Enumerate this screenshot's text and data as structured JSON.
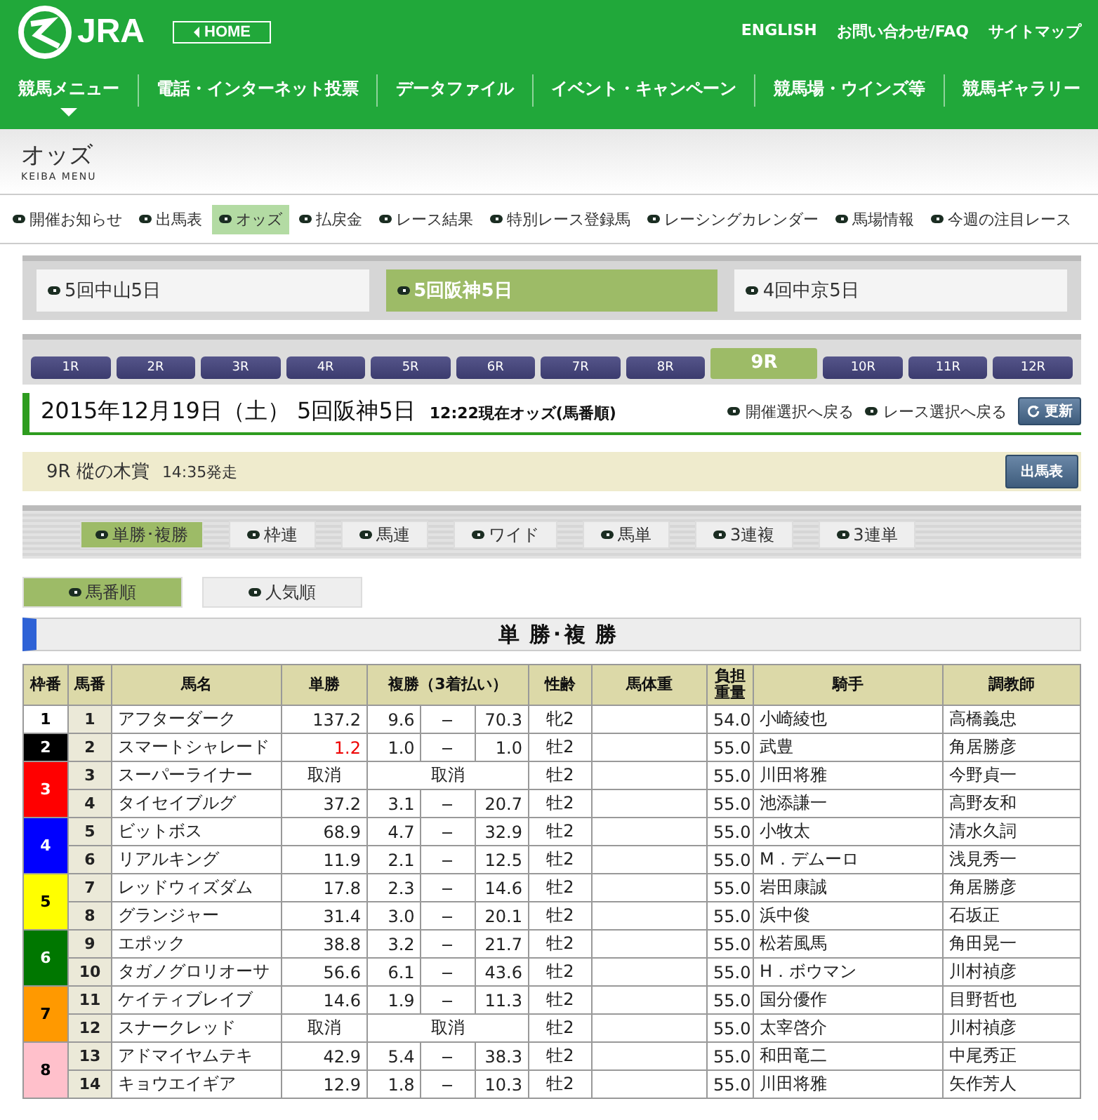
{
  "header": {
    "logo_text": "JRA",
    "home_button": "HOME",
    "utility_links": [
      "ENGLISH",
      "お問い合わせ/FAQ",
      "サイトマップ"
    ],
    "main_nav": [
      {
        "label": "競馬メニュー",
        "selected": true
      },
      {
        "label": "電話・インターネット投票",
        "selected": false
      },
      {
        "label": "データファイル",
        "selected": false
      },
      {
        "label": "イベント・キャンペーン",
        "selected": false
      },
      {
        "label": "競馬場・ウインズ等",
        "selected": false
      },
      {
        "label": "競馬ギャラリー",
        "selected": false
      }
    ]
  },
  "page_title": "オッズ",
  "page_subtitle": "KEIBA MENU",
  "sub_nav": [
    {
      "label": "開催お知らせ",
      "selected": false
    },
    {
      "label": "出馬表",
      "selected": false
    },
    {
      "label": "オッズ",
      "selected": true
    },
    {
      "label": "払戻金",
      "selected": false
    },
    {
      "label": "レース結果",
      "selected": false
    },
    {
      "label": "特別レース登録馬",
      "selected": false
    },
    {
      "label": "レーシングカレンダー",
      "selected": false
    },
    {
      "label": "馬場情報",
      "selected": false
    },
    {
      "label": "今週の注目レース",
      "selected": false
    }
  ],
  "venues": [
    {
      "label": "5回中山5日",
      "selected": false
    },
    {
      "label": "5回阪神5日",
      "selected": true
    },
    {
      "label": "4回中京5日",
      "selected": false
    }
  ],
  "races": [
    {
      "label": "1R",
      "selected": false
    },
    {
      "label": "2R",
      "selected": false
    },
    {
      "label": "3R",
      "selected": false
    },
    {
      "label": "4R",
      "selected": false
    },
    {
      "label": "5R",
      "selected": false
    },
    {
      "label": "6R",
      "selected": false
    },
    {
      "label": "7R",
      "selected": false
    },
    {
      "label": "8R",
      "selected": false
    },
    {
      "label": "9R",
      "selected": true
    },
    {
      "label": "10R",
      "selected": false
    },
    {
      "label": "11R",
      "selected": false
    },
    {
      "label": "12R",
      "selected": false
    }
  ],
  "heading": {
    "title": "2015年12月19日（土） 5回阪神5日",
    "timestamp": "12:22現在オッズ(馬番順)",
    "back_links": [
      "開催選択へ戻る",
      "レース選択へ戻る"
    ],
    "refresh_button": "更新"
  },
  "race_info": {
    "name": "9R 樅の木賞",
    "start": "14:35発走",
    "entry_button": "出馬表"
  },
  "bet_types": [
    {
      "label": "単勝･複勝",
      "selected": true
    },
    {
      "label": "枠連",
      "selected": false
    },
    {
      "label": "馬連",
      "selected": false
    },
    {
      "label": "ワイド",
      "selected": false
    },
    {
      "label": "馬単",
      "selected": false
    },
    {
      "label": "3連複",
      "selected": false
    },
    {
      "label": "3連単",
      "selected": false
    }
  ],
  "sort_tabs": [
    {
      "label": "馬番順",
      "selected": true
    },
    {
      "label": "人気順",
      "selected": false
    }
  ],
  "section_title": "単 勝･複 勝",
  "table": {
    "columns": [
      "枠番",
      "馬番",
      "馬名",
      "単勝",
      "複勝（3着払い）",
      "性齢",
      "馬体重",
      "負担重量",
      "騎手",
      "調教師"
    ],
    "frames": [
      {
        "number": "1",
        "color": "#ffffff",
        "horses": [
          {
            "kind": "normal",
            "number": "1",
            "name": "アフターダーク",
            "win": "137.2",
            "favorite": false,
            "place_low": "9.6",
            "place_high": "70.3",
            "sex_age": "牝2",
            "weight": "54.0",
            "jockey": "小崎綾也",
            "trainer": "高橋義忠"
          }
        ]
      },
      {
        "number": "2",
        "color": "#000000",
        "horses": [
          {
            "kind": "normal",
            "number": "2",
            "name": "スマートシャレード",
            "win": "1.2",
            "favorite": true,
            "place_low": "1.0",
            "place_high": "1.0",
            "sex_age": "牡2",
            "weight": "55.0",
            "jockey": "武豊",
            "trainer": "角居勝彦"
          }
        ]
      },
      {
        "number": "3",
        "color": "#ff0000",
        "horses": [
          {
            "kind": "scratched",
            "number": "3",
            "name": "スーパーライナー",
            "win": "取消",
            "place": "取消",
            "sex_age": "牡2",
            "weight": "55.0",
            "jockey": "川田将雅",
            "trainer": "今野貞一"
          },
          {
            "kind": "normal",
            "number": "4",
            "name": "タイセイブルグ",
            "win": "37.2",
            "favorite": false,
            "place_low": "3.1",
            "place_high": "20.7",
            "sex_age": "牡2",
            "weight": "55.0",
            "jockey": "池添謙一",
            "trainer": "高野友和"
          }
        ]
      },
      {
        "number": "4",
        "color": "#0000ff",
        "horses": [
          {
            "kind": "normal",
            "number": "5",
            "name": "ビットボス",
            "win": "68.9",
            "favorite": false,
            "place_low": "4.7",
            "place_high": "32.9",
            "sex_age": "牡2",
            "weight": "55.0",
            "jockey": "小牧太",
            "trainer": "清水久詞"
          },
          {
            "kind": "normal",
            "number": "6",
            "name": "リアルキング",
            "win": "11.9",
            "favorite": false,
            "place_low": "2.1",
            "place_high": "12.5",
            "sex_age": "牡2",
            "weight": "55.0",
            "jockey": "M．デムーロ",
            "trainer": "浅見秀一"
          }
        ]
      },
      {
        "number": "5",
        "color": "#ffff00",
        "horses": [
          {
            "kind": "normal",
            "number": "7",
            "name": "レッドウィズダム",
            "win": "17.8",
            "favorite": false,
            "place_low": "2.3",
            "place_high": "14.6",
            "sex_age": "牡2",
            "weight": "55.0",
            "jockey": "岩田康誠",
            "trainer": "角居勝彦"
          },
          {
            "kind": "normal",
            "number": "8",
            "name": "グランジャー",
            "win": "31.4",
            "favorite": false,
            "place_low": "3.0",
            "place_high": "20.1",
            "sex_age": "牡2",
            "weight": "55.0",
            "jockey": "浜中俊",
            "trainer": "石坂正"
          }
        ]
      },
      {
        "number": "6",
        "color": "#007700",
        "horses": [
          {
            "kind": "normal",
            "number": "9",
            "name": "エポック",
            "win": "38.8",
            "favorite": false,
            "place_low": "3.2",
            "place_high": "21.7",
            "sex_age": "牡2",
            "weight": "55.0",
            "jockey": "松若風馬",
            "trainer": "角田晃一"
          },
          {
            "kind": "normal",
            "number": "10",
            "name": "タガノグロリオーサ",
            "win": "56.6",
            "favorite": false,
            "place_low": "6.1",
            "place_high": "43.6",
            "sex_age": "牡2",
            "weight": "55.0",
            "jockey": "H．ボウマン",
            "trainer": "川村禎彦"
          }
        ]
      },
      {
        "number": "7",
        "color": "#ff9900",
        "horses": [
          {
            "kind": "normal",
            "number": "11",
            "name": "ケイティブレイブ",
            "win": "14.6",
            "favorite": false,
            "place_low": "1.9",
            "place_high": "11.3",
            "sex_age": "牡2",
            "weight": "55.0",
            "jockey": "国分優作",
            "trainer": "目野哲也"
          },
          {
            "kind": "scratched",
            "number": "12",
            "name": "スナークレッド",
            "win": "取消",
            "place": "取消",
            "sex_age": "牡2",
            "weight": "55.0",
            "jockey": "太宰啓介",
            "trainer": "川村禎彦"
          }
        ]
      },
      {
        "number": "8",
        "color": "#ffc0cb",
        "horses": [
          {
            "kind": "normal",
            "number": "13",
            "name": "アドマイヤムテキ",
            "win": "42.9",
            "favorite": false,
            "place_low": "5.4",
            "place_high": "38.3",
            "sex_age": "牡2",
            "weight": "55.0",
            "jockey": "和田竜二",
            "trainer": "中尾秀正"
          },
          {
            "kind": "normal",
            "number": "14",
            "name": "キョウエイギア",
            "win": "12.9",
            "favorite": false,
            "place_low": "1.8",
            "place_high": "10.3",
            "sex_age": "牡2",
            "weight": "55.0",
            "jockey": "川田将雅",
            "trainer": "矢作芳人"
          }
        ]
      }
    ]
  }
}
